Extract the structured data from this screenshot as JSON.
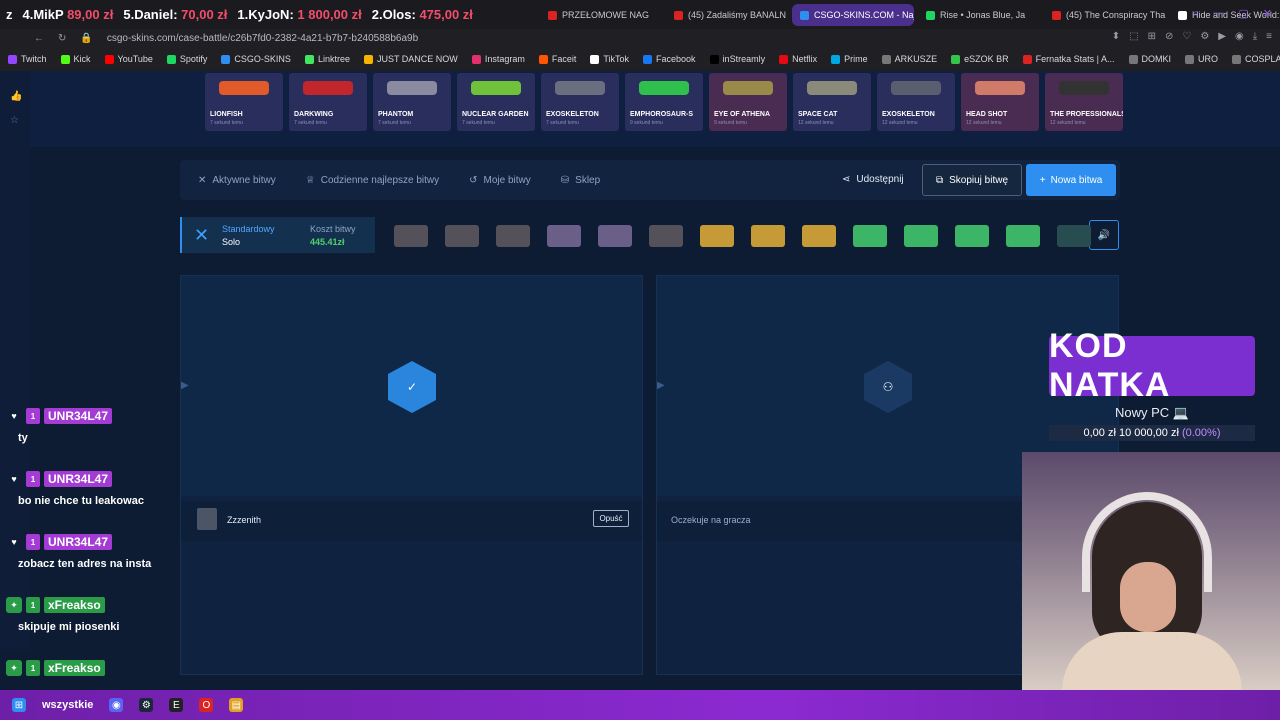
{
  "ticker": [
    {
      "rank": "4.",
      "name": "MikP",
      "amount": "89,00 zł"
    },
    {
      "rank": "5.",
      "name": "Daniel:",
      "amount": "70,00 zł"
    },
    {
      "rank": "1.",
      "name": "KyJoN:",
      "amount": "1 800,00 zł"
    },
    {
      "rank": "2.",
      "name": "Olos:",
      "amount": "475,00 zł"
    }
  ],
  "browser": {
    "tabs": [
      {
        "label": "PRZEŁOMOWE NAG",
        "color": "#d22"
      },
      {
        "label": "(45) Zadaliśmy BANALN",
        "color": "#d22"
      },
      {
        "label": "CSGO-SKINS.COM - Naj",
        "color": "#2e8ff0"
      },
      {
        "label": "Rise • Jonas Blue, Ja",
        "color": "#1ed760"
      },
      {
        "label": "(45) The Conspiracy Tha",
        "color": "#d22"
      },
      {
        "label": "Hide and Seek World: On",
        "color": "#fff"
      }
    ],
    "new_tab": "+",
    "url": "csgo-skins.com/case-battle/c26b7fd0-2382-4a21-b7b7-b240588b6a9b",
    "bookmarks": [
      {
        "label": "Twitch",
        "color": "#9146ff"
      },
      {
        "label": "Kick",
        "color": "#53fc18"
      },
      {
        "label": "YouTube",
        "color": "#ff0000"
      },
      {
        "label": "Spotify",
        "color": "#1ed760"
      },
      {
        "label": "CSGO-SKINS",
        "color": "#2e8ff0"
      },
      {
        "label": "Linktree",
        "color": "#43e660"
      },
      {
        "label": "JUST DANCE NOW",
        "color": "#f5b400"
      },
      {
        "label": "Instagram",
        "color": "#e1306c"
      },
      {
        "label": "Faceit",
        "color": "#ff5500"
      },
      {
        "label": "TikTok",
        "color": "#fff"
      },
      {
        "label": "Facebook",
        "color": "#1877f2"
      },
      {
        "label": "inStreamly",
        "color": "#000"
      },
      {
        "label": "Netflix",
        "color": "#e50914"
      },
      {
        "label": "Prime",
        "color": "#00a8e1"
      },
      {
        "label": "ARKUSZE",
        "color": "#777"
      },
      {
        "label": "eSZOK BR",
        "color": "#35c34a"
      },
      {
        "label": "Fernatka Stats | A...",
        "color": "#d22"
      },
      {
        "label": "DOMKI",
        "color": "#777"
      },
      {
        "label": "URO",
        "color": "#777"
      },
      {
        "label": "COSPLAYE",
        "color": "#777"
      }
    ]
  },
  "drops": [
    {
      "name": "LIONFISH",
      "ago": "7 sekund temu",
      "color": "#e05a2a",
      "pink": false
    },
    {
      "name": "DARKWING",
      "ago": "7 sekund temu",
      "color": "#c0262b",
      "pink": false
    },
    {
      "name": "PHANTOM",
      "ago": "7 sekund temu",
      "color": "#8a8aa0",
      "pink": false
    },
    {
      "name": "NUCLEAR GARDEN",
      "ago": "7 sekund temu",
      "color": "#6fc23a",
      "pink": false
    },
    {
      "name": "EXOSKELETON",
      "ago": "7 sekund temu",
      "color": "#6a6f80",
      "pink": false
    },
    {
      "name": "EMPHOROSAUR-S",
      "ago": "9 sekund temu",
      "color": "#2fbf4c",
      "pink": false
    },
    {
      "name": "EYE OF ATHENA",
      "ago": "9 sekund temu",
      "color": "#9a8a4a",
      "pink": true
    },
    {
      "name": "SPACE CAT",
      "ago": "12 sekund temu",
      "color": "#8a8a7a",
      "pink": false
    },
    {
      "name": "EXOSKELETON",
      "ago": "12 sekund temu",
      "color": "#5a5f70",
      "pink": false
    },
    {
      "name": "HEAD SHOT",
      "ago": "12 sekund temu",
      "color": "#d07a6a",
      "pink": true
    },
    {
      "name": "THE PROFESSIONALS",
      "ago": "12 sekund temu",
      "color": "#333",
      "pink": true
    }
  ],
  "nav": {
    "active": "Aktywne bitwy",
    "daily": "Codzienne najlepsze bitwy",
    "mine": "Moje bitwy",
    "shop": "Sklep",
    "share": "Udostępnij",
    "copy": "Skopiuj bitwę",
    "new": "Nowa bitwa"
  },
  "mode": {
    "type": "Standardowy",
    "players": "Solo",
    "cost_label": "Koszt bitwy",
    "cost": "445.41zł"
  },
  "cases": [
    "dark",
    "dark",
    "dark",
    "purp",
    "purp",
    "dark",
    "gold",
    "gold",
    "gold",
    "green",
    "green",
    "green",
    "green",
    "faded"
  ],
  "battle": {
    "player1": "Zzzenith",
    "leave": "Opuść",
    "waiting": "Oczekuje na gracza"
  },
  "overlay": {
    "code": "KOD NATKA",
    "goal_title": "Nowy PC",
    "goal_value": "0,00 zł  10 000,00 zł",
    "goal_pct": "(0.00%)"
  },
  "chat": [
    {
      "user": "UNR34L47",
      "text": "ty",
      "green": false
    },
    {
      "user": "UNR34L47",
      "text": "bo nie chce tu leakowac",
      "green": false
    },
    {
      "user": "UNR34L47",
      "text": "zobacz ten adres na insta",
      "green": false
    },
    {
      "user": "xFreakso",
      "text": "skipuje mi piosenki",
      "green": true
    },
    {
      "user": "xFreakso",
      "text": "",
      "green": true
    }
  ],
  "taskbar": {
    "search": "wszystkie"
  }
}
